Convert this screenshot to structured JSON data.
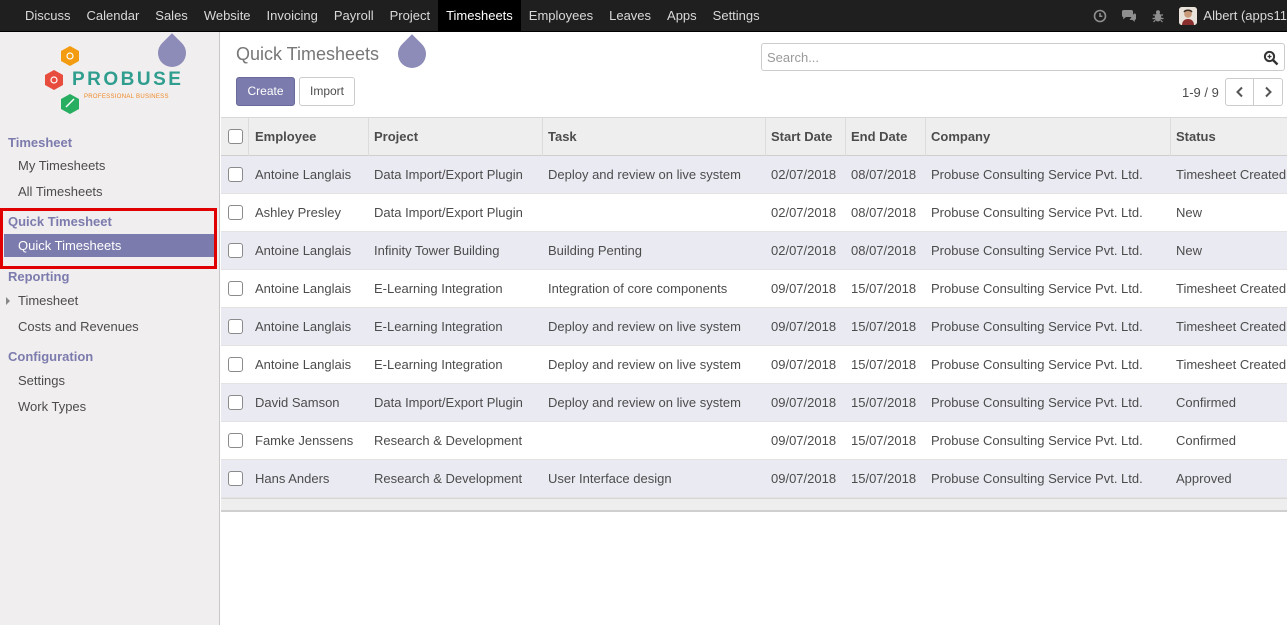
{
  "topbar": {
    "menu": [
      "Discuss",
      "Calendar",
      "Sales",
      "Website",
      "Invoicing",
      "Payroll",
      "Project",
      "Timesheets",
      "Employees",
      "Leaves",
      "Apps",
      "Settings"
    ],
    "active_menu": "Timesheets",
    "icons": [
      "clock-icon",
      "chat-icon",
      "bug-icon"
    ],
    "user_name": "Albert (apps11"
  },
  "logo": {
    "brand": "PROBUSE",
    "tagline": "PROFESSIONAL BUSINESS"
  },
  "sidebar": {
    "sections": [
      {
        "title": "Timesheet",
        "items": [
          "My Timesheets",
          "All Timesheets"
        ]
      },
      {
        "title": "Quick Timesheet",
        "items": [
          "Quick Timesheets"
        ]
      },
      {
        "title": "Reporting",
        "items": [
          "Timesheet",
          "Costs and Revenues"
        ]
      },
      {
        "title": "Configuration",
        "items": [
          "Settings",
          "Work Types"
        ]
      }
    ],
    "active_item": "Quick Timesheets"
  },
  "page": {
    "title": "Quick Timesheets",
    "create_label": "Create",
    "import_label": "Import",
    "search_placeholder": "Search...",
    "pager": "1-9 / 9"
  },
  "table": {
    "columns": [
      "Employee",
      "Project",
      "Task",
      "Start Date",
      "End Date",
      "Company",
      "Status"
    ],
    "rows": [
      [
        "Antoine Langlais",
        "Data Import/Export Plugin",
        "Deploy and review on live system",
        "02/07/2018",
        "08/07/2018",
        "Probuse Consulting Service Pvt. Ltd.",
        "Timesheet Created"
      ],
      [
        "Ashley Presley",
        "Data Import/Export Plugin",
        "",
        "02/07/2018",
        "08/07/2018",
        "Probuse Consulting Service Pvt. Ltd.",
        "New"
      ],
      [
        "Antoine Langlais",
        "Infinity Tower Building",
        "Building Penting",
        "02/07/2018",
        "08/07/2018",
        "Probuse Consulting Service Pvt. Ltd.",
        "New"
      ],
      [
        "Antoine Langlais",
        "E-Learning Integration",
        "Integration of core components",
        "09/07/2018",
        "15/07/2018",
        "Probuse Consulting Service Pvt. Ltd.",
        "Timesheet Created"
      ],
      [
        "Antoine Langlais",
        "E-Learning Integration",
        "Deploy and review on live system",
        "09/07/2018",
        "15/07/2018",
        "Probuse Consulting Service Pvt. Ltd.",
        "Timesheet Created"
      ],
      [
        "Antoine Langlais",
        "E-Learning Integration",
        "Deploy and review on live system",
        "09/07/2018",
        "15/07/2018",
        "Probuse Consulting Service Pvt. Ltd.",
        "Timesheet Created"
      ],
      [
        "David Samson",
        "Data Import/Export Plugin",
        "Deploy and review on live system",
        "09/07/2018",
        "15/07/2018",
        "Probuse Consulting Service Pvt. Ltd.",
        "Confirmed"
      ],
      [
        "Famke Jenssens",
        "Research & Development",
        "",
        "09/07/2018",
        "15/07/2018",
        "Probuse Consulting Service Pvt. Ltd.",
        "Confirmed"
      ],
      [
        "Hans Anders",
        "Research & Development",
        "User Interface design",
        "09/07/2018",
        "15/07/2018",
        "Probuse Consulting Service Pvt. Ltd.",
        "Approved"
      ]
    ]
  },
  "colors": {
    "accent": "#7c7bad",
    "topbar": "#1f1f1f",
    "highlight": "#e00000"
  }
}
